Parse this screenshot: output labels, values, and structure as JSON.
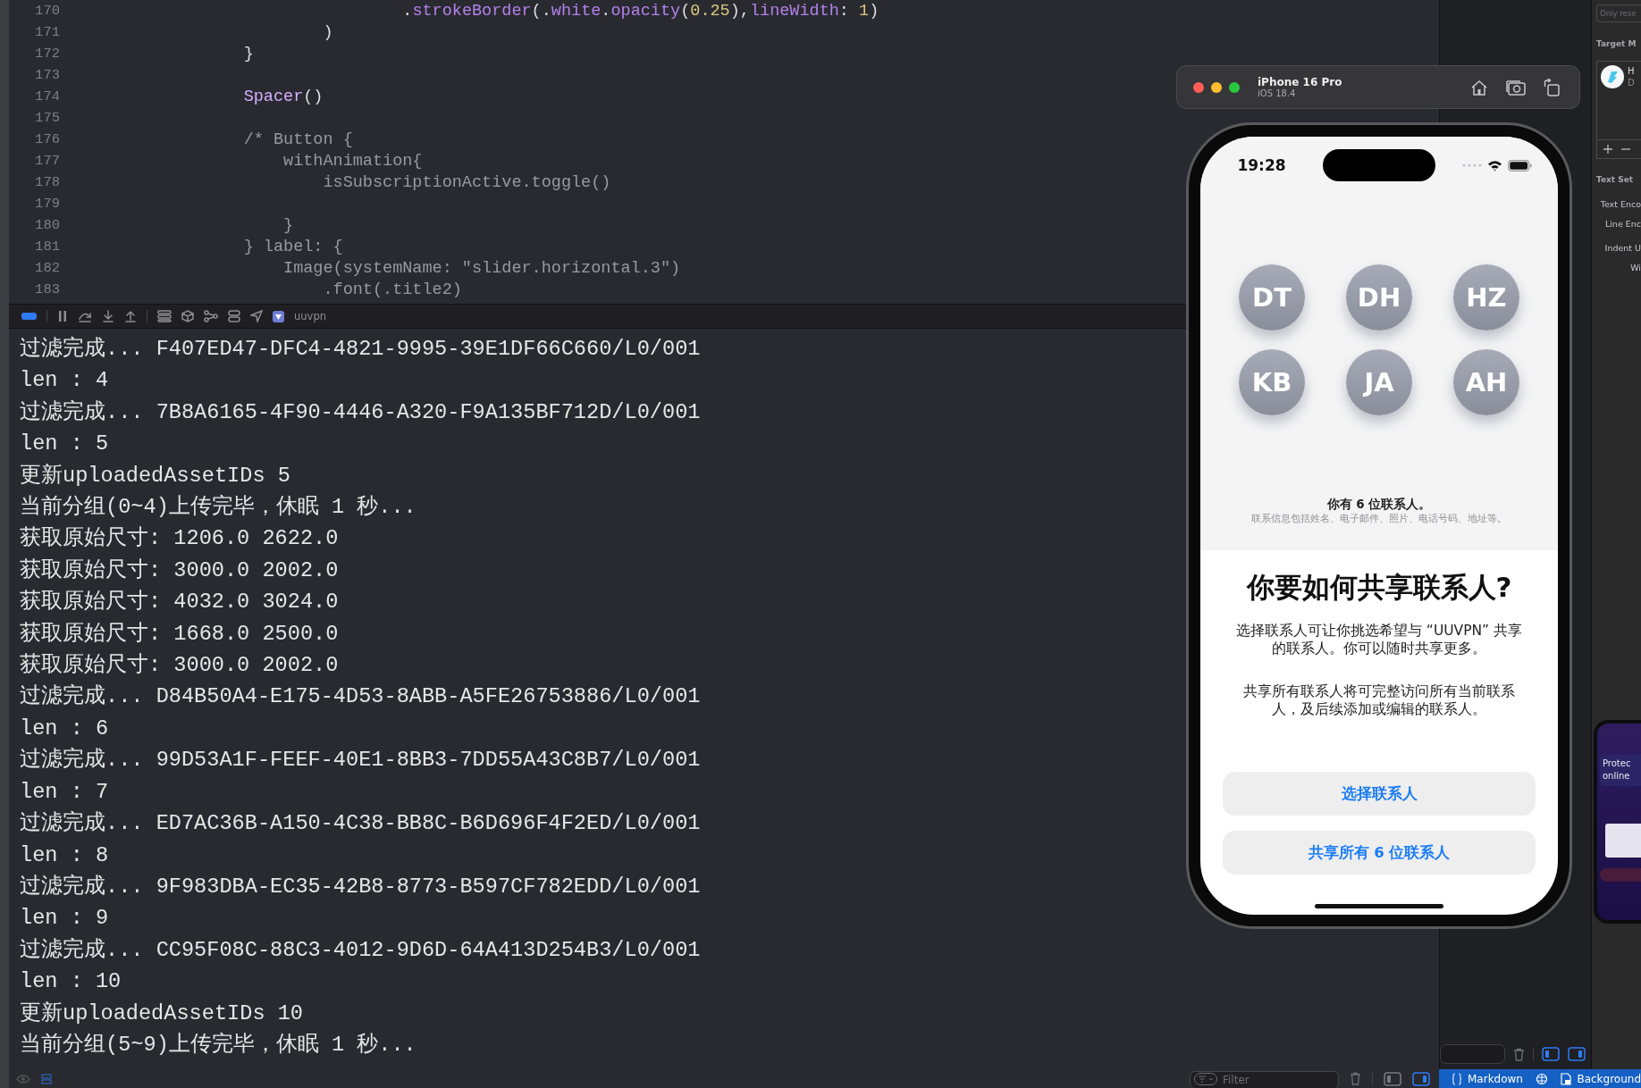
{
  "editor": {
    "lines": [
      {
        "number": "170",
        "tokens": [
          {
            "text": "                                .",
            "kind": "plain"
          },
          {
            "text": "strokeBorder",
            "kind": "member"
          },
          {
            "text": "(.",
            "kind": "plain"
          },
          {
            "text": "white",
            "kind": "member"
          },
          {
            "text": ".",
            "kind": "plain"
          },
          {
            "text": "opacity",
            "kind": "member"
          },
          {
            "text": "(",
            "kind": "plain"
          },
          {
            "text": "0.25",
            "kind": "number"
          },
          {
            "text": "),",
            "kind": "plain"
          },
          {
            "text": "lineWidth",
            "kind": "member"
          },
          {
            "text": ": ",
            "kind": "plain"
          },
          {
            "text": "1",
            "kind": "number"
          },
          {
            "text": ")",
            "kind": "plain"
          }
        ]
      },
      {
        "number": "171",
        "tokens": [
          {
            "text": "                        )",
            "kind": "plain"
          }
        ]
      },
      {
        "number": "172",
        "tokens": [
          {
            "text": "                }",
            "kind": "plain"
          }
        ]
      },
      {
        "number": "173"
      },
      {
        "number": "174",
        "tokens": [
          {
            "text": "                Spacer",
            "kind": "type"
          },
          {
            "text": "()",
            "kind": "plain"
          }
        ]
      },
      {
        "number": "175"
      },
      {
        "number": "176",
        "tokens": [
          {
            "text": "                /* Button {",
            "kind": "comment"
          }
        ]
      },
      {
        "number": "177",
        "tokens": [
          {
            "text": "                    withAnimation{",
            "kind": "comment"
          }
        ]
      },
      {
        "number": "178",
        "tokens": [
          {
            "text": "                        isSubscriptionActive.toggle()",
            "kind": "comment"
          }
        ]
      },
      {
        "number": "179"
      },
      {
        "number": "180",
        "tokens": [
          {
            "text": "                    }",
            "kind": "comment"
          }
        ]
      },
      {
        "number": "181",
        "tokens": [
          {
            "text": "                } label: {",
            "kind": "comment"
          }
        ]
      },
      {
        "number": "182",
        "tokens": [
          {
            "text": "                    Image(systemName: \"slider.horizontal.3\")",
            "kind": "comment"
          }
        ]
      },
      {
        "number": "183",
        "tokens": [
          {
            "text": "                        .font(.title2)",
            "kind": "comment"
          }
        ]
      }
    ]
  },
  "debug_bar": {
    "target": "uuvpn"
  },
  "console": {
    "lines": [
      "过滤完成... F407ED47-DFC4-4821-9995-39E1DF66C660/L0/001",
      "len : 4",
      "过滤完成... 7B8A6165-4F90-4446-A320-F9A135BF712D/L0/001",
      "len : 5",
      "更新uploadedAssetIDs 5",
      "当前分组(0~4)上传完毕，休眠 1 秒...",
      "获取原始尺寸: 1206.0 2622.0",
      "获取原始尺寸: 3000.0 2002.0",
      "获取原始尺寸: 4032.0 3024.0",
      "获取原始尺寸: 1668.0 2500.0",
      "获取原始尺寸: 3000.0 2002.0",
      "过滤完成... D84B50A4-E175-4D53-8ABB-A5FE26753886/L0/001",
      "len : 6",
      "过滤完成... 99D53A1F-FEEF-40E1-8BB3-7DD55A43C8B7/L0/001",
      "len : 7",
      "过滤完成... ED7AC36B-A150-4C38-BB8C-B6D696F4F2ED/L0/001",
      "len : 8",
      "过滤完成... 9F983DBA-EC35-42B8-8773-B597CF782EDD/L0/001",
      "len : 9",
      "过滤完成... CC95F08C-88C3-4012-9D6D-64A413D254B3/L0/001",
      "len : 10",
      "更新uploadedAssetIDs 10",
      "当前分组(5~9)上传完毕，休眠 1 秒..."
    ]
  },
  "console_toolbar": {
    "filter_placeholder": "Filter"
  },
  "simulator": {
    "device": "iPhone 16 Pro",
    "os": "iOS 18.4"
  },
  "phone": {
    "time": "19:28",
    "avatars": [
      "DT",
      "DH",
      "HZ",
      "KB",
      "JA",
      "AH"
    ],
    "count_text": "你有 6 位联系人。",
    "detail": "联系信息包括姓名、电子邮件、照片、电话号码、地址等。",
    "title": "你要如何共享联系人?",
    "paragraphs": [
      "选择联系人可让你挑选希望与 “UUVPN” 共享的联系人。你可以随时共享更多。",
      "共享所有联系人将可完整访问所有当前联系人，及后续添加或编辑的联系人。"
    ],
    "buttons": [
      "选择联系人",
      "共享所有 6 位联系人"
    ]
  },
  "inspector": {
    "search_placeholder": "Only rese",
    "target_title": "Target M",
    "target_item": {
      "title": "H",
      "subtitle": "D"
    },
    "text_settings_title": "Text Set",
    "settings": [
      "Text Enco",
      "Line Enc",
      "Indent U",
      "Wi"
    ]
  },
  "mini_preview": {
    "headline": [
      "Protec",
      "online"
    ]
  },
  "status_bar": {
    "language": "Markdown",
    "mode": "Background"
  }
}
